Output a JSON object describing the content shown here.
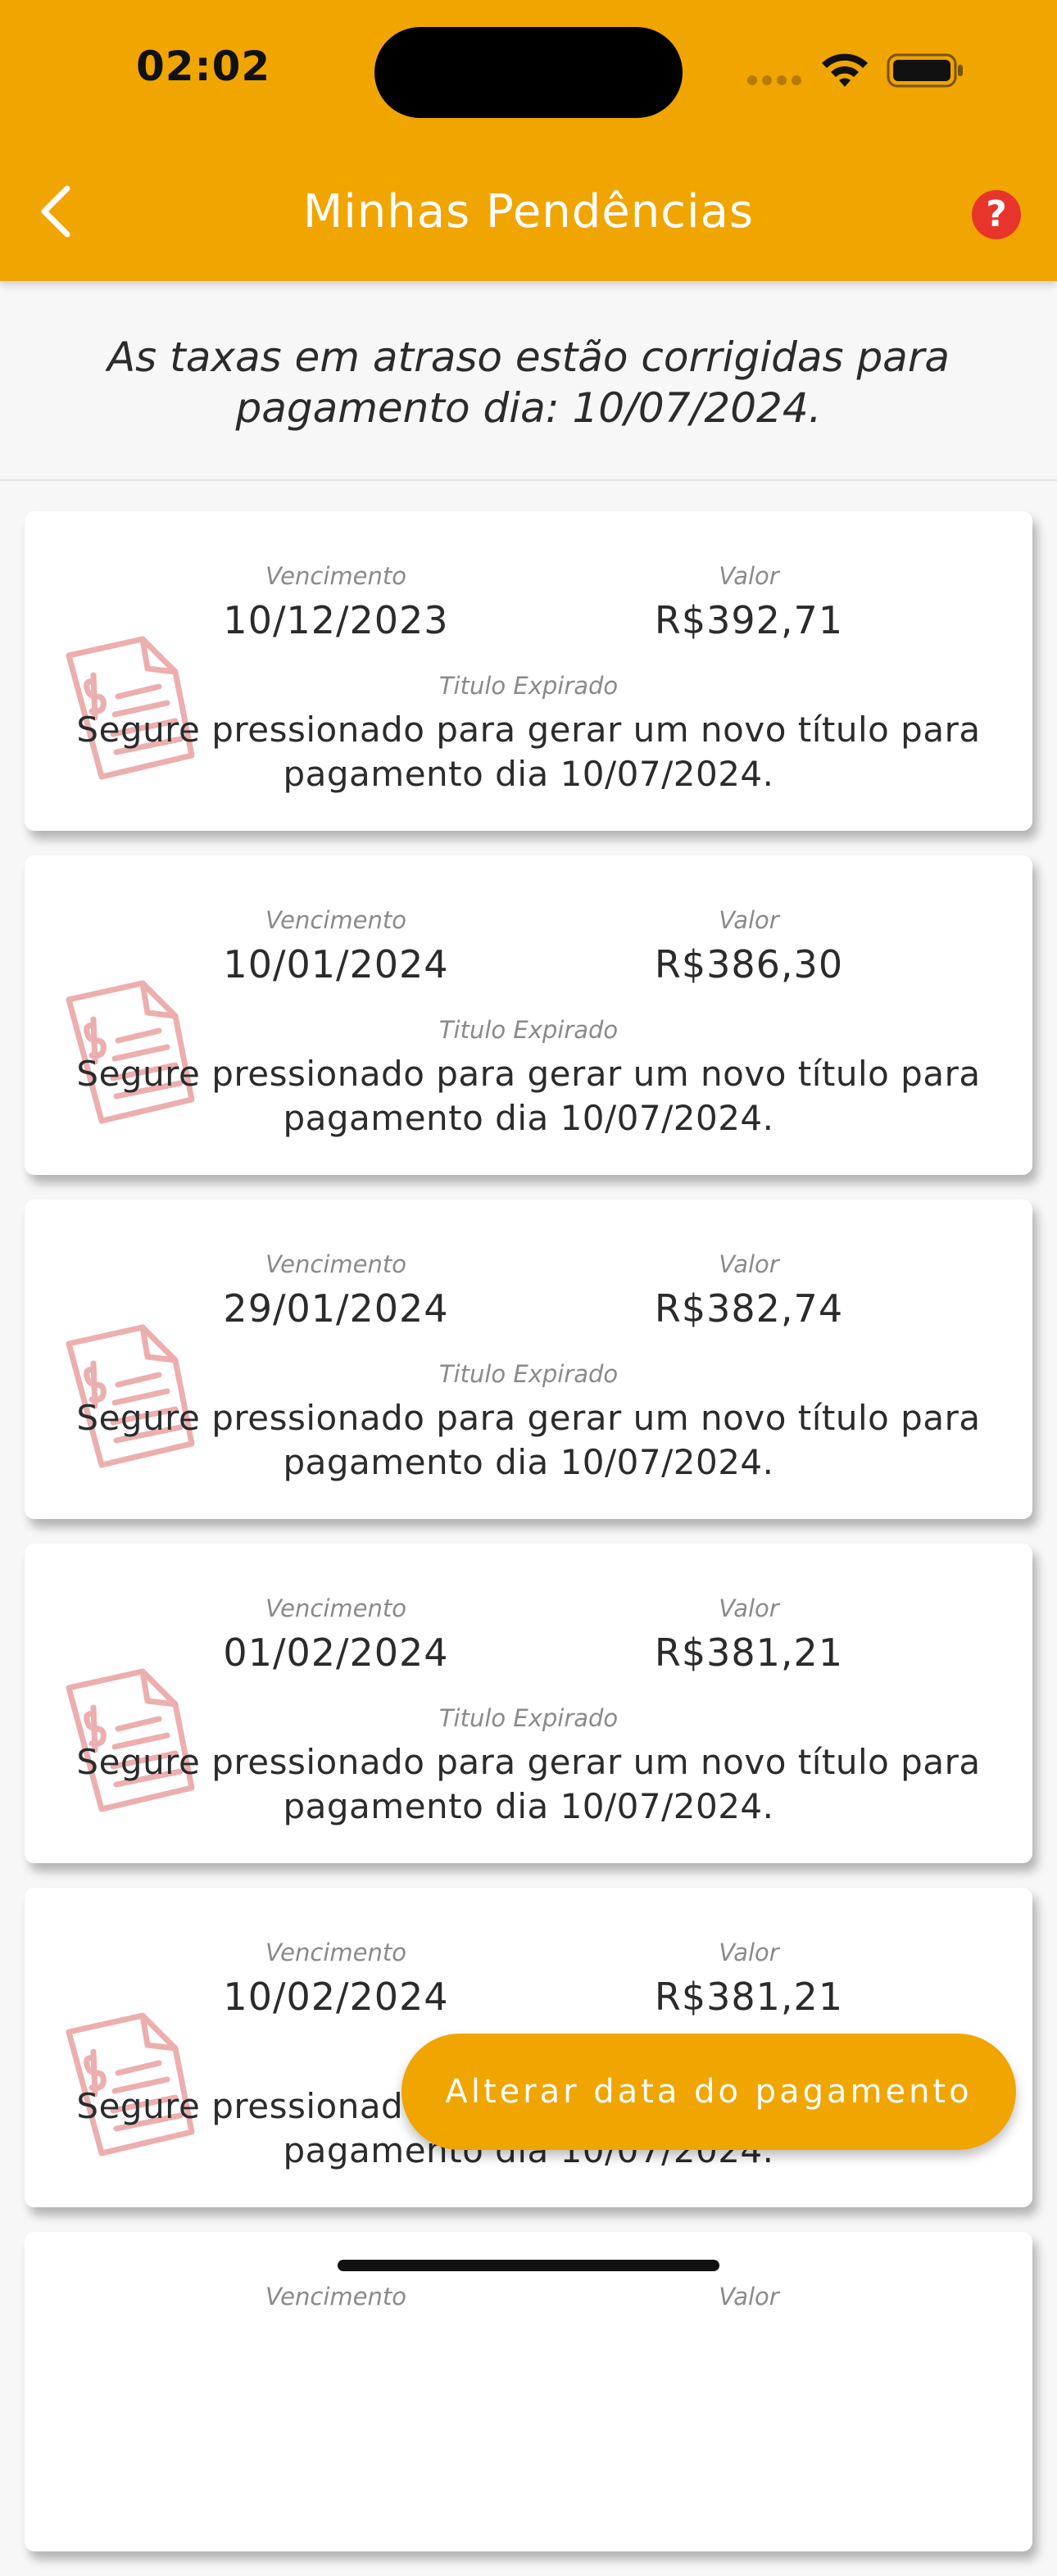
{
  "status_bar": {
    "time": "02:02"
  },
  "header": {
    "title": "Minhas Pendências",
    "help_symbol": "?"
  },
  "notice": {
    "text": "As taxas em atraso estão corrigidas para pagamento dia: 10/07/2024."
  },
  "labels": {
    "due": "Vencimento",
    "value": "Valor",
    "status": "Titulo Expirado"
  },
  "bills": [
    {
      "due_date": "10/12/2023",
      "value": "R$392,71",
      "message": "Segure pressionado para gerar um novo título para pagamento dia 10/07/2024."
    },
    {
      "due_date": "10/01/2024",
      "value": "R$386,30",
      "message": "Segure pressionado para gerar um novo título para pagamento dia 10/07/2024."
    },
    {
      "due_date": "29/01/2024",
      "value": "R$382,74",
      "message": "Segure pressionado para gerar um novo título para pagamento dia 10/07/2024."
    },
    {
      "due_date": "01/02/2024",
      "value": "R$381,21",
      "message": "Segure pressionado para gerar um novo título para pagamento dia 10/07/2024."
    },
    {
      "due_date": "10/02/2024",
      "value": "R$381,21",
      "message": "Segure pressionado para gerar um novo título para pagamento dia 10/07/2024."
    },
    {
      "due_date": "",
      "value": "",
      "message": ""
    }
  ],
  "fab": {
    "label": "Alterar data do pagamento"
  },
  "colors": {
    "accent": "#f0a500",
    "help": "#e8352c",
    "icon": "#e07a7a"
  }
}
